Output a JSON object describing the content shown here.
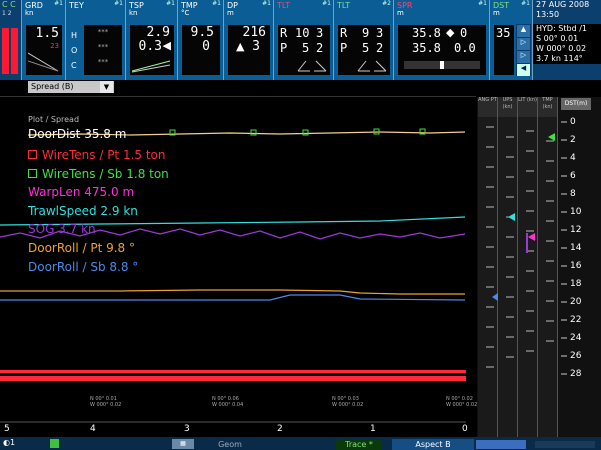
{
  "topbar": {
    "corner": {
      "letters": "C C",
      "digits": "1 2"
    },
    "grd": {
      "title": "GRD",
      "unit": "kn",
      "num": "#1",
      "value": "1.5",
      "sub": "23"
    },
    "tey": {
      "title": "TEY",
      "num": "#1",
      "letters": [
        "H",
        "O",
        "C"
      ],
      "dots": [
        "***",
        "***",
        "***"
      ]
    },
    "tsp": {
      "title": "TSP",
      "unit": "kn",
      "num": "#1",
      "value1": "2.9",
      "value2": "0.3"
    },
    "tmp": {
      "title": "TMP",
      "unit": "°C",
      "num": "#1",
      "value1": "9.5",
      "value2": "0"
    },
    "dp": {
      "title": "DP",
      "unit": "m",
      "num": "#1",
      "value1": "216",
      "value2": "3"
    },
    "pt1": {
      "title": "TLT",
      "num": "#1",
      "r": "R",
      "p": "P",
      "r1": "10",
      "r2": "3",
      "p1": "5",
      "p2": "2"
    },
    "pt2": {
      "title": "TLT",
      "num": "#2",
      "r": "R",
      "p": "P",
      "r1": "9",
      "r2": "3",
      "p1": "5",
      "p2": "2"
    },
    "spr": {
      "title": "SPR",
      "unit": "m",
      "num": "#1",
      "value1": "35.8",
      "value2": "0",
      "value3": "35.8",
      "value4": "0.0"
    },
    "dst": {
      "title": "DST",
      "unit": "m",
      "num": "#1",
      "value": "35"
    },
    "datetime": {
      "date": "27 AUG 2008",
      "time": "13:50"
    },
    "hyd": {
      "label": "HYD: Stbd /1",
      "s": "S  00° 0.01",
      "w": "W 000° 0.02",
      "speed": "3.7 kn  114°"
    }
  },
  "dropdown": {
    "value": "Spread (B)",
    "arrow": "▼"
  },
  "legend": {
    "header": "Plot / Spread",
    "items": [
      {
        "text": "DoorDist 35.8 m",
        "color": "#ffffff"
      },
      {
        "text": "WireTens / Pt 1.5 ton",
        "color": "#ff2a3a",
        "box": true
      },
      {
        "text": "WireTens / Sb 1.8 ton",
        "color": "#40e040",
        "box": true
      },
      {
        "text": "WarpLen 475.0 m",
        "color": "#ff2fd8"
      },
      {
        "text": "TrawlSpeed 2.9 kn",
        "color": "#30e0e0"
      },
      {
        "text": "SOG 3.7 kn",
        "color": "#9a3ad8"
      },
      {
        "text": "DoorRoll / Pt 9.8 °",
        "color": "#f0a030"
      },
      {
        "text": "DoorRoll / Sb 8.8 °",
        "color": "#4a8ae8"
      }
    ]
  },
  "timeaxis": {
    "labels": [
      "5",
      "4",
      "3",
      "2",
      "1",
      "0"
    ],
    "notes": [
      {
        "n": "N 00° 0.01",
        "w": "W 000° 0.02"
      },
      {
        "n": "N 00° 0.06",
        "w": "W 000° 0.04"
      },
      {
        "n": "N 00° 0.03",
        "w": "W 000° 0.02"
      },
      {
        "n": "N 00° 0.02",
        "w": "W 000° 0.02"
      }
    ]
  },
  "rightpanel": {
    "cols": [
      "ANG PT",
      "UPS (kn)",
      "LIT (kn)",
      "TMP (kn)"
    ],
    "dsthdr": "DST(m)",
    "scale": [
      "0",
      "2",
      "4",
      "6",
      "8",
      "10",
      "12",
      "14",
      "16",
      "18",
      "20",
      "22",
      "24",
      "26",
      "28"
    ]
  },
  "bottombar": {
    "left": "◐1",
    "tabs": [
      "Geom",
      "Trace *",
      "Aspect B"
    ]
  }
}
